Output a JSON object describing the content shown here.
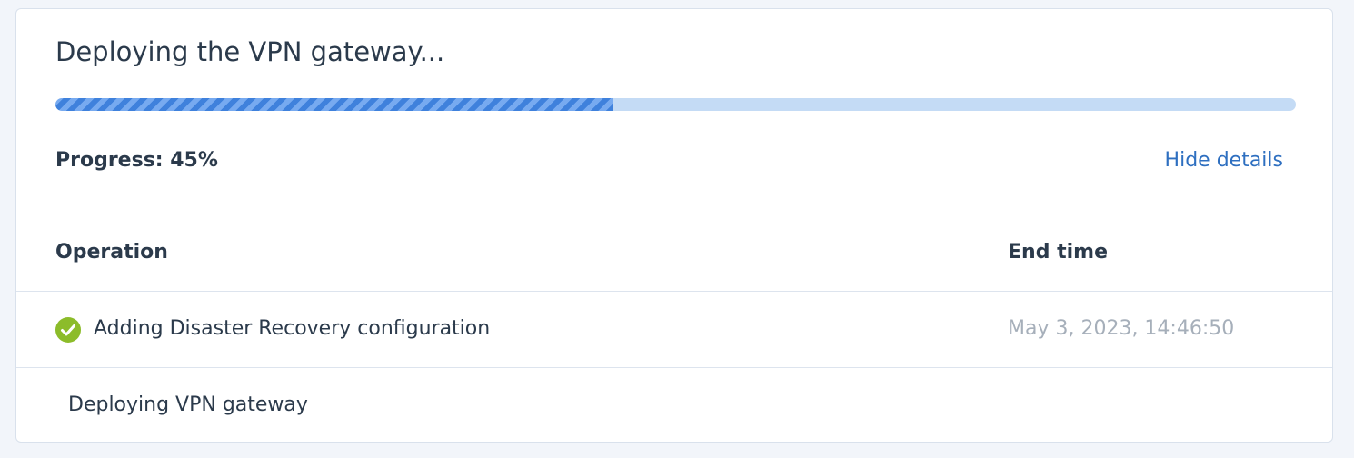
{
  "task": {
    "title": "Deploying the VPN gateway...",
    "progress_label": "Progress: 45%",
    "progress_fraction": 0.45,
    "hide_details_label": "Hide details"
  },
  "colors": {
    "accent": "#4a8be3",
    "link": "#2e6fc0",
    "success": "#8cbc2a",
    "muted_text": "#a6afba"
  },
  "table": {
    "columns": [
      "Operation",
      "End time"
    ],
    "rows": [
      {
        "operation": "Adding Disaster Recovery configuration",
        "end_time": "May 3, 2023, 14:46:50",
        "status_icon": "check-circle-icon"
      },
      {
        "operation": "Deploying VPN gateway",
        "end_time": ""
      }
    ]
  }
}
